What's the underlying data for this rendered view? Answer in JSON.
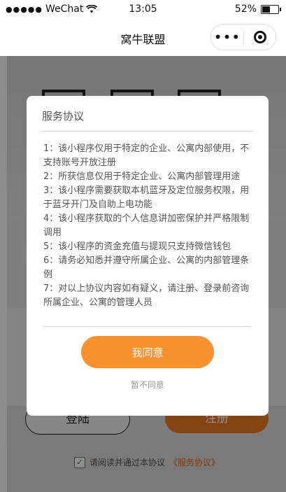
{
  "status_bar": {
    "signal": "●●●●●",
    "carrier": "WeChat",
    "time": "13:05",
    "battery_percent": "52%",
    "battery_level": 0.52,
    "wifi_icon": "wifi-icon"
  },
  "nav": {
    "title": "窝牛联盟",
    "more_icon": "•••",
    "target_icon": "target-icon"
  },
  "background": {
    "login_label": "登陆",
    "register_label": "注册",
    "agree_prefix": "请阅读并通过本协议",
    "agree_link": "《服务协议》",
    "agree_checked": true
  },
  "modal": {
    "title": "服务协议",
    "terms": [
      "1：该小程序仅用于特定的企业、公寓内部使用，不支持账号开放注册",
      "2：所获信息仅用于特定企业、公寓内部管理用途",
      "3：该小程序需要获取本机蓝牙及定位服务权限，用于蓝牙开门及自助上电功能",
      "4：该小程序获取的个人信息讲加密保护并严格限制调用",
      "5：该小程序的资金充值与提现只支持微信钱包",
      "6：请务必知悉并遵守所属企业、公寓的内部管理条例",
      "7：对以上协议内容如有疑义，请注册、登录前咨询所属企业、公寓的管理人员"
    ],
    "agree_button": "我同意",
    "disagree_button": "暂不同意"
  },
  "colors": {
    "accent": "#f7922f",
    "register_bg": "#f07f22",
    "link": "#e36a1a"
  }
}
